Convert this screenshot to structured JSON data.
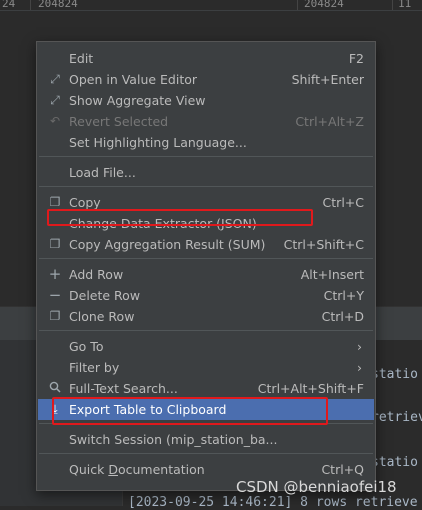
{
  "grid": {
    "cells": [
      "24",
      "204824",
      "204824",
      "11"
    ]
  },
  "log_lines": [
    "statio",
    "retrieve",
    "statio",
    "[2023-09-25 14:46:21] 8 rows retrieve"
  ],
  "menu": {
    "edit": {
      "label": "Edit",
      "shortcut": "F2"
    },
    "open_value_editor": {
      "label": "Open in Value Editor",
      "shortcut": "Shift+Enter",
      "icon": "expand-icon"
    },
    "show_aggregate": {
      "label": "Show Aggregate View",
      "icon": "expand-icon"
    },
    "revert_selected": {
      "label": "Revert Selected",
      "shortcut": "Ctrl+Alt+Z",
      "icon": "undo-icon"
    },
    "set_highlighting": {
      "label": "Set Highlighting Language..."
    },
    "load_file": {
      "label": "Load File..."
    },
    "copy": {
      "label": "Copy",
      "shortcut": "Ctrl+C",
      "icon": "copy-icon"
    },
    "change_extractor": {
      "label": "Change Data Extractor (JSON)"
    },
    "copy_aggregation": {
      "label": "Copy Aggregation Result (SUM)",
      "shortcut": "Ctrl+Shift+C",
      "icon": "copy-icon"
    },
    "add_row": {
      "label": "Add Row",
      "shortcut": "Alt+Insert",
      "icon": "plus-icon"
    },
    "delete_row": {
      "label": "Delete Row",
      "shortcut": "Ctrl+Y",
      "icon": "minus-icon"
    },
    "clone_row": {
      "label": "Clone Row",
      "shortcut": "Ctrl+D",
      "icon": "copy-icon"
    },
    "go_to": {
      "label": "Go To"
    },
    "filter_by": {
      "label": "Filter by"
    },
    "full_text_search": {
      "label": "Full-Text Search...",
      "shortcut": "Ctrl+Alt+Shift+F",
      "icon": "search-icon"
    },
    "export_table": {
      "label": "Export Table to Clipboard",
      "icon": "export-icon"
    },
    "switch_session": {
      "label": "Switch Session (mip_station_ba..."
    },
    "quick_docs": {
      "label_pre": "Quick ",
      "label_u": "D",
      "label_post": "ocumentation",
      "shortcut": "Ctrl+Q"
    }
  },
  "watermark": "CSDN @benniaofei18",
  "colors": {
    "selection": "#4b6eaf",
    "highlight_box": "#e0191c",
    "menu_bg": "#3c3f41"
  }
}
